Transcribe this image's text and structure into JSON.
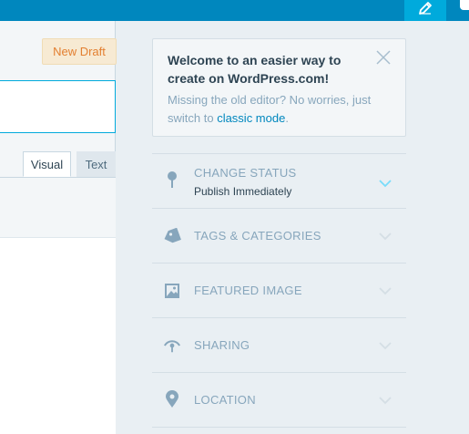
{
  "header": {
    "new_draft_label": "New Draft"
  },
  "editor": {
    "tabs": [
      {
        "label": "Visual"
      },
      {
        "label": "Text"
      }
    ]
  },
  "welcome": {
    "title": "Welcome to an easier way to create on WordPress.com!",
    "text_before": "Missing the old editor? No worries, just switch to ",
    "link": "classic mode",
    "text_after": "."
  },
  "sidebar": {
    "sections": [
      {
        "label": "CHANGE STATUS",
        "sub": "Publish Immediately",
        "icon": "pin-icon",
        "expanded_color": "#78dcfa"
      },
      {
        "label": "TAGS & CATEGORIES",
        "icon": "tag-icon"
      },
      {
        "label": "FEATURED IMAGE",
        "icon": "image-icon"
      },
      {
        "label": "SHARING",
        "icon": "share-icon"
      },
      {
        "label": "LOCATION",
        "icon": "location-icon"
      }
    ]
  },
  "colors": {
    "topbar": "#0087be",
    "accent": "#00aadc",
    "muted": "#87a6bc",
    "text": "#2e4453",
    "draft_orange": "#e37f30"
  }
}
